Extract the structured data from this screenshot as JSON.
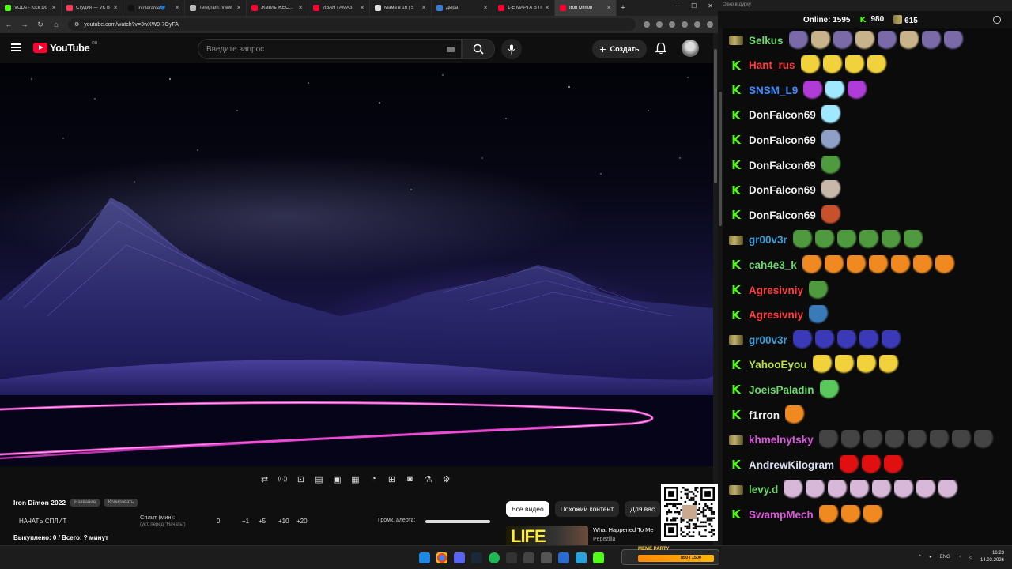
{
  "browser": {
    "tabs": [
      {
        "label": "VODs - Kick Do",
        "color": "#53fc18",
        "active": false
      },
      {
        "label": "Студия — VK В",
        "color": "#ff3b5c",
        "active": false
      },
      {
        "label": "Intolerante💙",
        "color": "#111111",
        "active": false
      },
      {
        "label": "Telegram: View",
        "color": "#bbbbbb",
        "active": false
      },
      {
        "label": "Жмиль ЖЁСТКИ",
        "color": "#ff0033",
        "active": false
      },
      {
        "label": "ИВАН ГАМАЗ",
        "color": "#ff0033",
        "active": false
      },
      {
        "label": "Мама в 16 | 5",
        "color": "#dddddd",
        "active": false
      },
      {
        "label": "Дыра",
        "color": "#3a7bd5",
        "active": false
      },
      {
        "label": "1-Е МАРТА В П",
        "color": "#ff0033",
        "active": false
      },
      {
        "label": "Iron Dimon",
        "color": "#ff0033",
        "active": true
      }
    ],
    "url": "youtube.com/watch?v=3wXW9-7OyFA"
  },
  "youtube": {
    "logo_text": "YouTube",
    "region": "RU",
    "search_placeholder": "Введите запрос",
    "create_label": "Создать"
  },
  "video": {
    "toolbar_icons": [
      "loop-icon",
      "broadcast-icon",
      "screen-record-icon",
      "clapper-icon",
      "pip-icon",
      "frames-icon",
      "speed-icon",
      "add-clip-icon",
      "screenshot-icon",
      "lab-icon",
      "settings-icon"
    ]
  },
  "below_video": {
    "channel": "Iron Dimon 2022",
    "pill1": "Названия",
    "pill2": "Копировать",
    "start_split": "НАЧАТЬ СПЛИТ",
    "split_label": "Сплит (мин):",
    "split_hint": "(уст. перед \"Начать\")",
    "split_value": "0",
    "increments": [
      "+1",
      "+5",
      "+10",
      "+20"
    ],
    "volume_label": "Громк. алерта:",
    "volume_level": 1.0,
    "done": "Выкуплено: 0 / Всего: ? минут"
  },
  "chips": [
    "Все видео",
    "Похожий контент",
    "Для вас"
  ],
  "recommendation": {
    "thumb_text": "LIFE",
    "title": "What Happened To Me",
    "channel": "Pepezilla"
  },
  "chat": {
    "header": "Окно в дурку",
    "online_label": "Online:",
    "online": "1595",
    "kick_count": "980",
    "gun_count": "615",
    "messages": [
      {
        "user": "Selkus",
        "color": "#6bd96b",
        "badge": "gun",
        "emotes": [
          "#7a6aa8",
          "#c9b38a",
          "#7a6aa8",
          "#c9b38a",
          "#7a6aa8",
          "#c9b38a",
          "#7a6aa8",
          "#7a6aa8"
        ]
      },
      {
        "user": "Hant_rus",
        "color": "#ff3b3b",
        "badge": "kick",
        "emotes": [
          "#f2d23c",
          "#f2d23c",
          "#f2d23c",
          "#f2d23c"
        ]
      },
      {
        "user": "SNSM_L9",
        "color": "#3d8bff",
        "badge": "kick",
        "emotes": [
          "#b03cd8",
          "#9fe8ff",
          "#b03cd8"
        ]
      },
      {
        "user": "DonFalcon69",
        "color": "#f0f0f0",
        "badge": "kick",
        "emotes": [
          "#9fe8ff"
        ]
      },
      {
        "user": "DonFalcon69",
        "color": "#f0f0f0",
        "badge": "kick",
        "emotes": [
          "#8ea0c8"
        ]
      },
      {
        "user": "DonFalcon69",
        "color": "#f0f0f0",
        "badge": "kick",
        "emotes": [
          "#4f9a3f"
        ]
      },
      {
        "user": "DonFalcon69",
        "color": "#f0f0f0",
        "badge": "kick",
        "emotes": [
          "#c8b8a8"
        ]
      },
      {
        "user": "DonFalcon69",
        "color": "#f0f0f0",
        "badge": "kick",
        "emotes": [
          "#c8502a"
        ]
      },
      {
        "user": "gr00v3r",
        "color": "#3a9fd8",
        "badge": "gun",
        "emotes": [
          "#4f9a3f",
          "#4f9a3f",
          "#4f9a3f",
          "#4f9a3f",
          "#4f9a3f",
          "#4f9a3f"
        ]
      },
      {
        "user": "cah4e3_k",
        "color": "#6bd96b",
        "badge": "kick",
        "emotes": [
          "#f08a20",
          "#f08a20",
          "#f08a20",
          "#f08a20",
          "#f08a20",
          "#f08a20",
          "#f08a20"
        ]
      },
      {
        "user": "Agresivniy",
        "color": "#ff3b3b",
        "badge": "kick",
        "emotes": [
          "#4f9a3f"
        ]
      },
      {
        "user": "Agresivniy",
        "color": "#ff3b3b",
        "badge": "kick",
        "emotes": [
          "#3a7ab8"
        ]
      },
      {
        "user": "gr00v3r",
        "color": "#3a9fd8",
        "badge": "gun",
        "emotes": [
          "#3a3ab8",
          "#3a3ab8",
          "#3a3ab8",
          "#3a3ab8",
          "#3a3ab8"
        ]
      },
      {
        "user": "YahooEyou",
        "color": "#b8e04a",
        "badge": "kick",
        "emotes": [
          "#f2d23c",
          "#f2d23c",
          "#f2d23c",
          "#f2d23c"
        ]
      },
      {
        "user": "JoeisPaladin",
        "color": "#6bd96b",
        "badge": "kick",
        "emotes": [
          "#5ac85a"
        ]
      },
      {
        "user": "f1rron",
        "color": "#f0f0f0",
        "badge": "kick",
        "emotes": [
          "#f08a20"
        ]
      },
      {
        "user": "khmelnytsky",
        "color": "#d85ad8",
        "badge": "gun",
        "emotes": [
          "#444444",
          "#444444",
          "#444444",
          "#444444",
          "#444444",
          "#444444",
          "#444444",
          "#444444"
        ]
      },
      {
        "user": "AndrewKilogram",
        "color": "#d8e0f0",
        "badge": "kick",
        "emotes": [
          "#e01010",
          "#e01010",
          "#e01010"
        ]
      },
      {
        "user": "levy.d",
        "color": "#6bd96b",
        "badge": "gun",
        "emotes": [
          "#d8b8d8",
          "#d8b8d8",
          "#d8b8d8",
          "#d8b8d8",
          "#d8b8d8",
          "#d8b8d8",
          "#d8b8d8",
          "#d8b8d8"
        ]
      },
      {
        "user": "SwampMech",
        "color": "#d85ad8",
        "badge": "kick",
        "emotes": [
          "#f08a20",
          "#f08a20",
          "#f08a20"
        ]
      }
    ]
  },
  "taskbar": {
    "meme_title": "MEME PARTY",
    "meme_value": "850 / 1500",
    "lang": "ENG",
    "time": "16:23",
    "date": "14.03.2026"
  }
}
